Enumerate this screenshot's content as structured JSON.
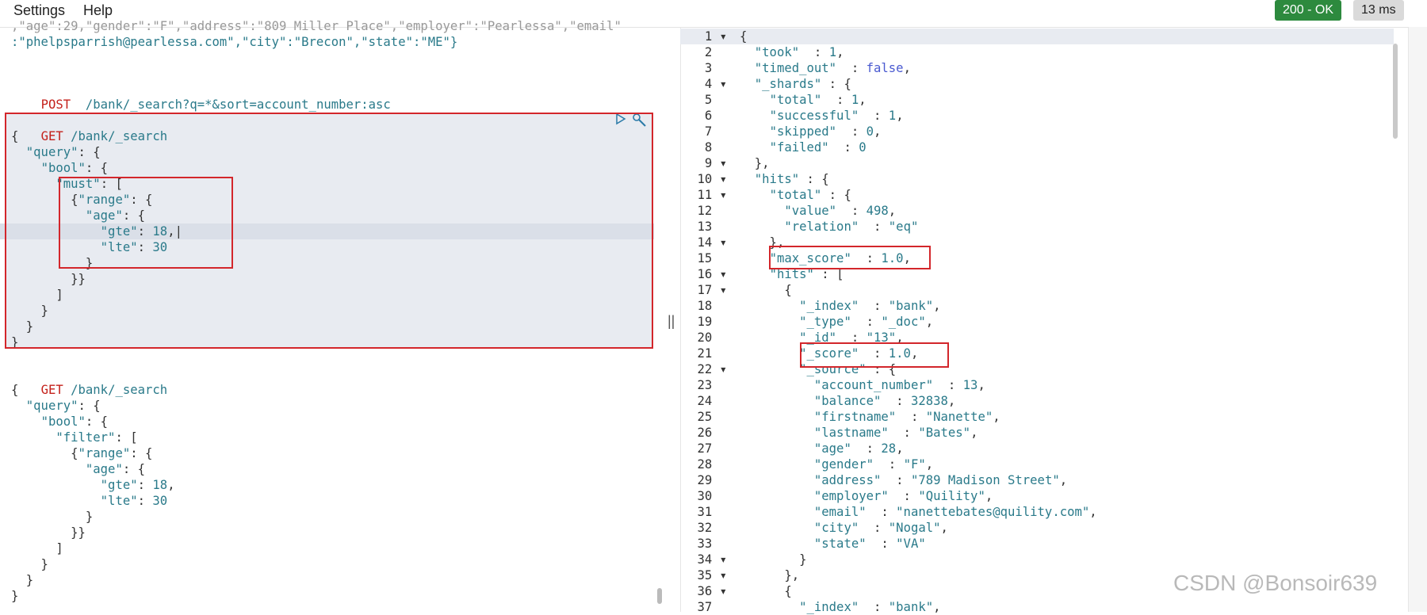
{
  "menu": {
    "settings": "Settings",
    "help": "Help"
  },
  "status": {
    "label": "200 - OK",
    "time": "13 ms",
    "ok_color": "#2d8a3e",
    "time_color": "#dadada"
  },
  "left": {
    "line0": ",\"age\":29,\"gender\":\"F\",\"address\":\"809 Miller Place\",\"employer\":\"Pearlessa\",\"email\"",
    "line1": ":\"phelpsparrish@pearlessa.com\",\"city\":\"Brecon\",\"state\":\"ME\"}",
    "post_method": "POST",
    "post_path": "/bank/_search?q=*&sort=account_number:asc",
    "get1_method": "GET",
    "get1_path": "/bank/_search",
    "get2_method": "GET",
    "get2_path": "/bank/_search"
  },
  "right_lines": [
    "{",
    "  \"took\" : 1,",
    "  \"timed_out\" : false,",
    "  \"_shards\" : {",
    "    \"total\" : 1,",
    "    \"successful\" : 1,",
    "    \"skipped\" : 0,",
    "    \"failed\" : 0",
    "  },",
    "  \"hits\" : {",
    "    \"total\" : {",
    "      \"value\" : 498,",
    "      \"relation\" : \"eq\"",
    "    },",
    "    \"max_score\" : 1.0,",
    "    \"hits\" : [",
    "      {",
    "        \"_index\" : \"bank\",",
    "        \"_type\" : \"_doc\",",
    "        \"_id\" : \"13\",",
    "        \"_score\" : 1.0,",
    "        \"_source\" : {",
    "          \"account_number\" : 13,",
    "          \"balance\" : 32838,",
    "          \"firstname\" : \"Nanette\",",
    "          \"lastname\" : \"Bates\",",
    "          \"age\" : 28,",
    "          \"gender\" : \"F\",",
    "          \"address\" : \"789 Madison Street\",",
    "          \"employer\" : \"Quility\",",
    "          \"email\" : \"nanettebates@quility.com\",",
    "          \"city\" : \"Nogal\",",
    "          \"state\" : \"VA\"",
    "        }",
    "      },",
    "      {",
    "        \"_index\" : \"bank\","
  ],
  "watermark": "CSDN @Bonsoir639"
}
